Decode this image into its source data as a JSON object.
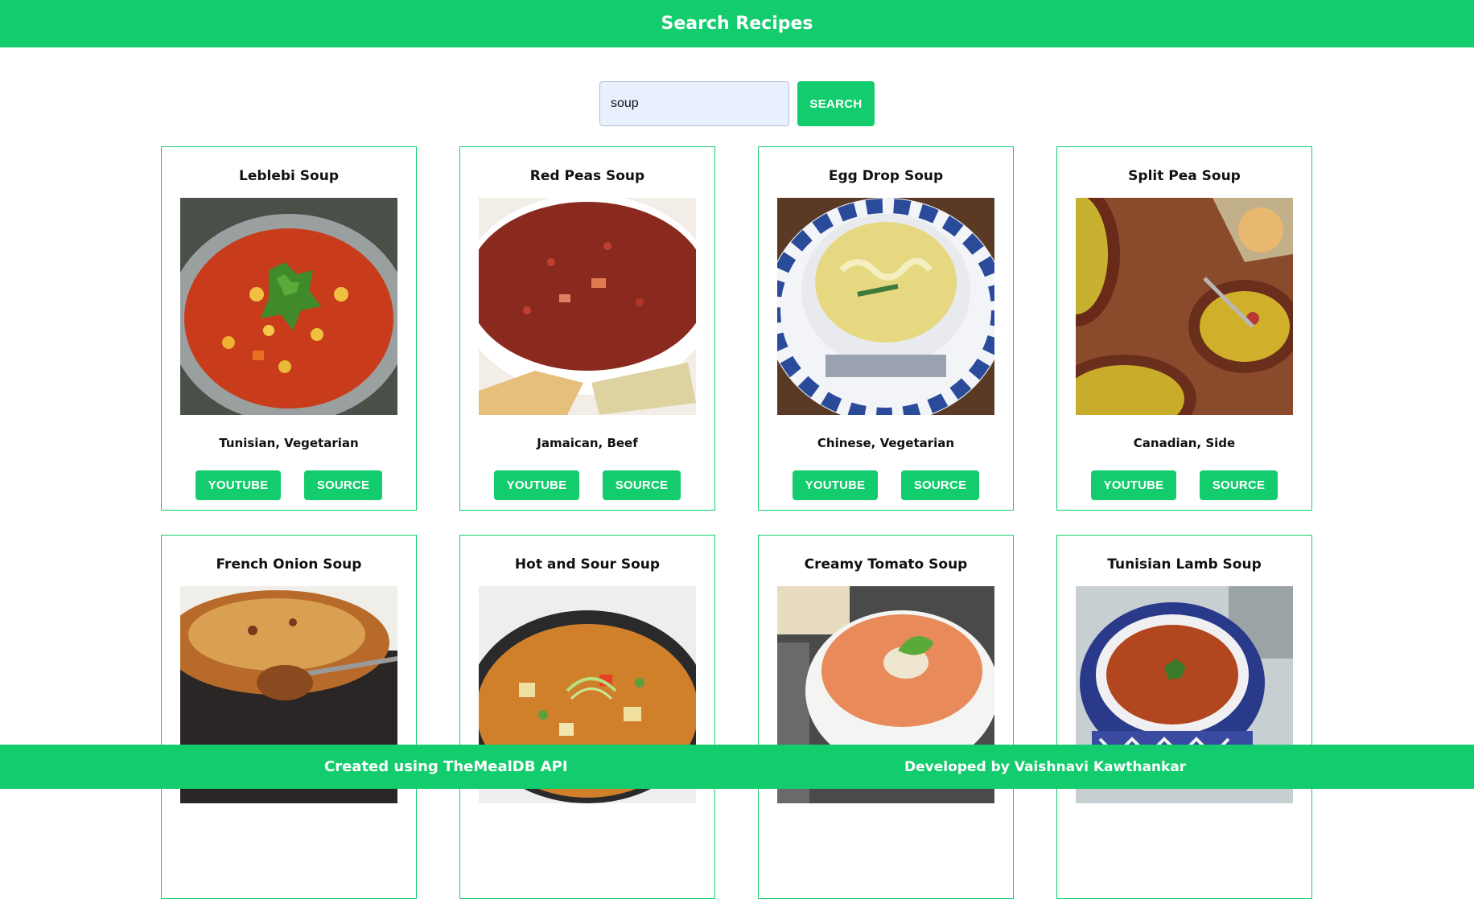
{
  "header": {
    "title": "Search Recipes"
  },
  "search": {
    "value": "soup",
    "button_label": "SEARCH"
  },
  "cards": [
    {
      "title": "Leblebi Soup",
      "tags": "Tunisian, Vegetarian",
      "youtube_label": "YOUTUBE",
      "source_label": "SOURCE"
    },
    {
      "title": "Red Peas Soup",
      "tags": "Jamaican, Beef",
      "youtube_label": "YOUTUBE",
      "source_label": "SOURCE"
    },
    {
      "title": "Egg Drop Soup",
      "tags": "Chinese, Vegetarian",
      "youtube_label": "YOUTUBE",
      "source_label": "SOURCE"
    },
    {
      "title": "Split Pea Soup",
      "tags": "Canadian, Side",
      "youtube_label": "YOUTUBE",
      "source_label": "SOURCE"
    },
    {
      "title": "French Onion Soup"
    },
    {
      "title": "Hot and Sour Soup"
    },
    {
      "title": "Creamy Tomato Soup"
    },
    {
      "title": "Tunisian Lamb Soup"
    }
  ],
  "footer": {
    "left": "Created using TheMealDB API",
    "right": "Developed by Vaishnavi Kawthankar"
  },
  "colors": {
    "accent": "#13cc6d",
    "input_bg": "#e8f0fe"
  }
}
